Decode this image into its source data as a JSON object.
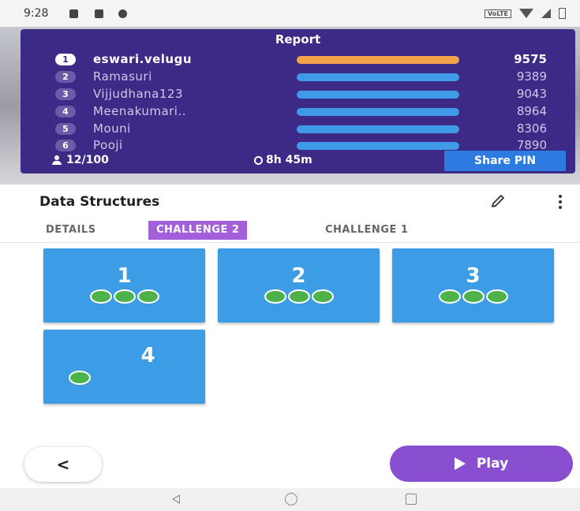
{
  "status_bar": {
    "time": "9:28",
    "network_label": "VoLTE"
  },
  "report": {
    "title": "Report",
    "leaderboard": [
      {
        "rank": "1",
        "name": "eswari.velugu",
        "score": "9575",
        "bar_fraction": 1.0
      },
      {
        "rank": "2",
        "name": "Ramasuri",
        "score": "9389",
        "bar_fraction": 1.0
      },
      {
        "rank": "3",
        "name": "Vijjudhana123",
        "score": "9043",
        "bar_fraction": 1.0
      },
      {
        "rank": "4",
        "name": "Meenakumari..",
        "score": "8964",
        "bar_fraction": 1.0
      },
      {
        "rank": "5",
        "name": "Mouni",
        "score": "8306",
        "bar_fraction": 1.0
      },
      {
        "rank": "6",
        "name": "Pooji",
        "score": "7890",
        "bar_fraction": 1.0
      }
    ],
    "players": "12/100",
    "time_left": "8h 45m",
    "share_label": "Share PIN",
    "colors": {
      "panel": "#3d2a86",
      "leader_bar": "#f4a24a",
      "bar": "#3f9ae8",
      "share": "#2d7be0"
    }
  },
  "title": "Data Structures",
  "tabs": [
    {
      "label": "DETAILS",
      "active": false
    },
    {
      "label": "CHALLENGE 2",
      "active": true
    },
    {
      "label": "CHALLENGE 1",
      "active": false
    }
  ],
  "levels": [
    {
      "number": "1",
      "dots": 3
    },
    {
      "number": "2",
      "dots": 3
    },
    {
      "number": "3",
      "dots": 3
    },
    {
      "number": "4",
      "dots": 1
    }
  ],
  "back_label": "<",
  "play_label": "Play",
  "colors": {
    "level_card": "#3c9de6",
    "dot": "#4db24a",
    "play": "#8a4fd0",
    "tab_active": "#a25fd8"
  }
}
